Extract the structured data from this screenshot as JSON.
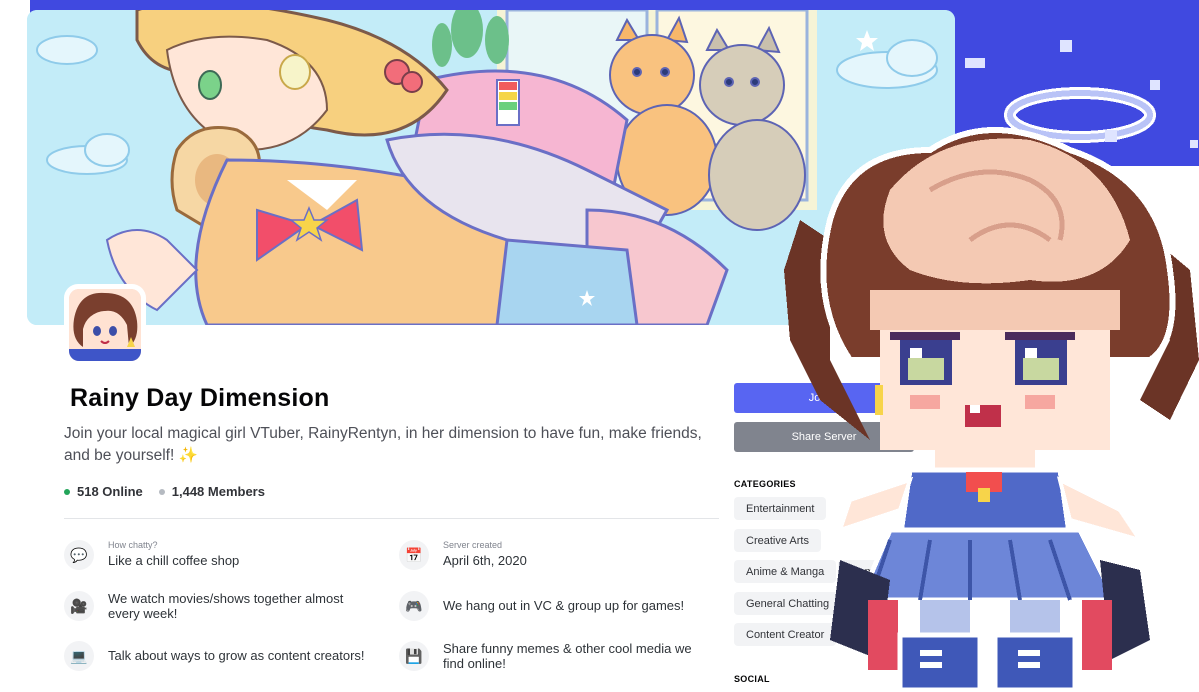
{
  "server": {
    "name": "Rainy Day Dimension",
    "description": "Join your local magical girl VTuber, RainyRentyn, in her dimension to have fun, make friends, and be yourself!",
    "description_emoji": "✨",
    "online_count": "518 Online",
    "member_count": "1,448 Members"
  },
  "facts": [
    {
      "icon": "speech-bubble-icon",
      "glyph": "💬",
      "small": "How chatty?",
      "text": "Like a chill coffee shop"
    },
    {
      "icon": "calendar-icon",
      "glyph": "📅",
      "small": "Server created",
      "text": "April 6th, 2020"
    },
    {
      "icon": "movie-camera-icon",
      "glyph": "🎥",
      "small": "",
      "text": "We watch movies/shows together almost every week!"
    },
    {
      "icon": "gamepad-icon",
      "glyph": "🎮",
      "small": "",
      "text": "We hang out in VC & group up for games!"
    },
    {
      "icon": "laptop-icon",
      "glyph": "💻",
      "small": "",
      "text": "Talk about ways to grow as content creators!"
    },
    {
      "icon": "floppy-disk-icon",
      "glyph": "💾",
      "small": "",
      "text": "Share funny memes & other cool media we find online!"
    }
  ],
  "actions": {
    "join_label": "Join S",
    "share_label": "Share Server"
  },
  "categories": {
    "heading": "CATEGORIES",
    "tags": [
      "Entertainment",
      "Creative Arts",
      "Anime & Manga",
      "Gamin",
      "General Chatting",
      "Content Creator"
    ]
  },
  "social": {
    "heading": "SOCIAL"
  },
  "colors": {
    "accent": "#5865f2",
    "top_band": "#4049e0",
    "online": "#23a55a"
  }
}
